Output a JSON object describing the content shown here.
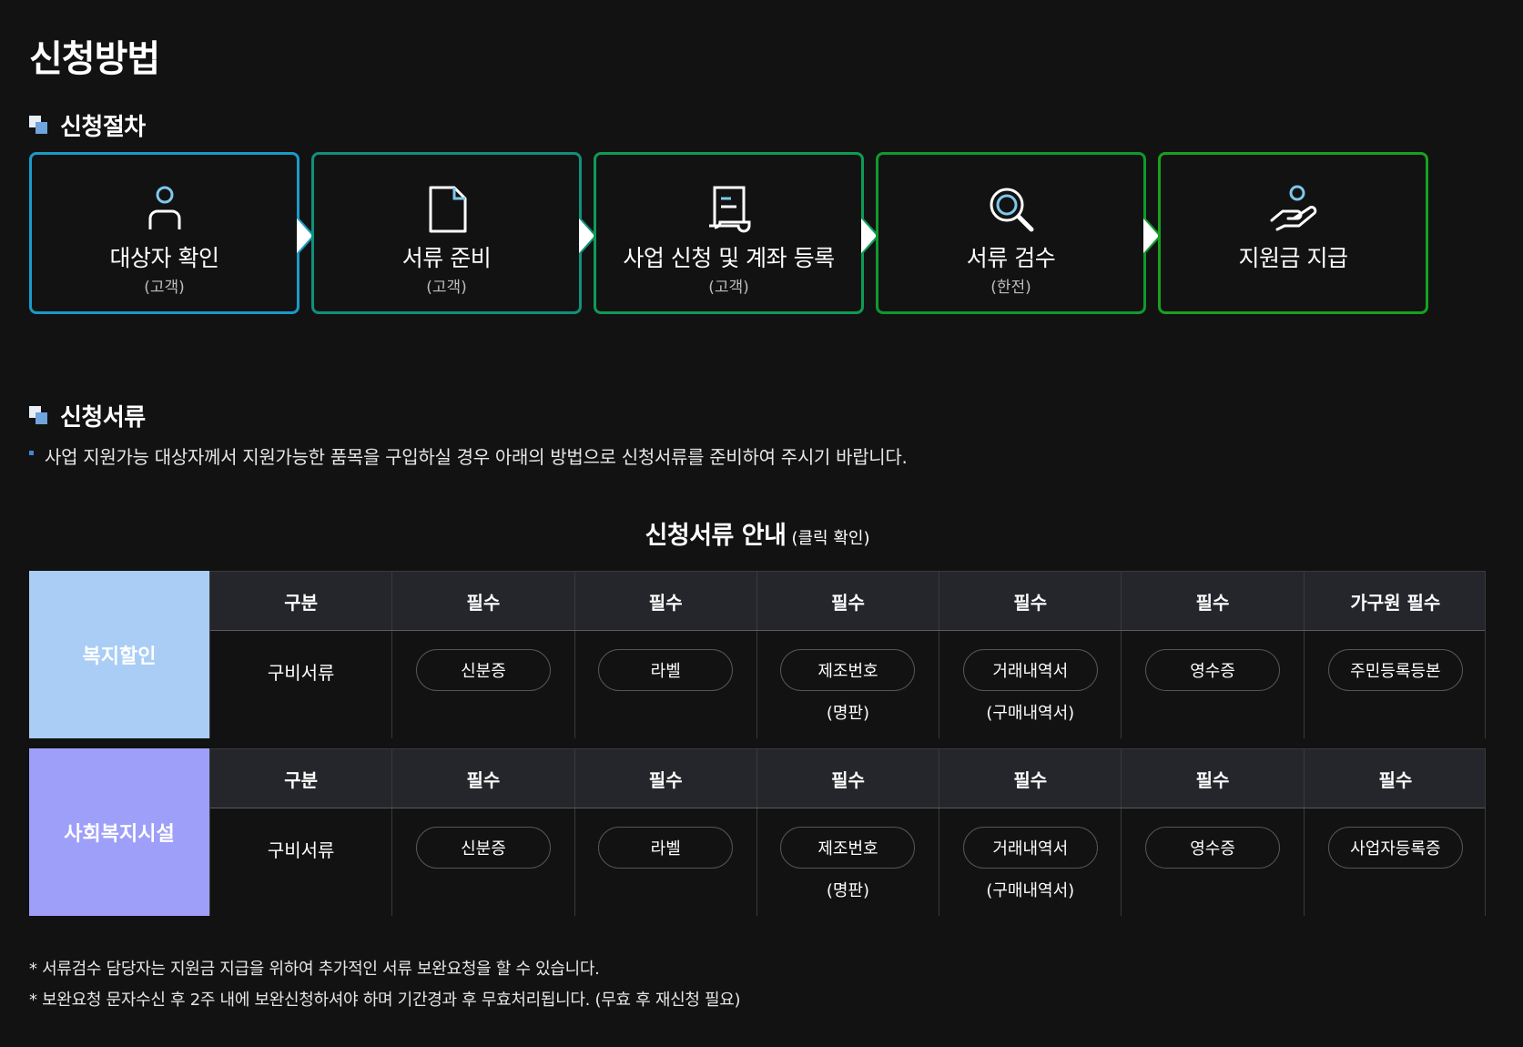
{
  "page_title": "신청방법",
  "procedure": {
    "heading": "신청절차",
    "steps": [
      {
        "name": "대상자 확인",
        "who": "(고객)",
        "icon": "person-icon",
        "color": "#1a9ac8"
      },
      {
        "name": "서류 준비",
        "who": "(고객)",
        "icon": "document-icon",
        "color": "#10907a"
      },
      {
        "name": "사업 신청 및 계좌 등록",
        "who": "(고객)",
        "icon": "form-icon",
        "color": "#0f9a55"
      },
      {
        "name": "서류 검수",
        "who": "(한전)",
        "icon": "magnifier-icon",
        "color": "#0e9a2e"
      },
      {
        "name": "지원금 지급",
        "who": "",
        "icon": "hand-money-icon",
        "color": "#17a21e"
      }
    ]
  },
  "documents": {
    "heading": "신청서류",
    "description": "사업 지원가능 대상자께서 지원가능한 품목을 구입하실 경우 아래의 방법으로 신청서류를 준비하여 주시기 바랍니다.",
    "table_title": "신청서류 안내",
    "table_title_note": "(클릭 확인)",
    "blocks": [
      {
        "category": "복지할인",
        "category_color": "#a9cdf4",
        "headers": [
          "구분",
          "필수",
          "필수",
          "필수",
          "필수",
          "필수",
          "가구원 필수"
        ],
        "row_label": "구비서류",
        "docs": [
          {
            "label": "신분증",
            "sub": ""
          },
          {
            "label": "라벨",
            "sub": ""
          },
          {
            "label": "제조번호",
            "sub": "(명판)"
          },
          {
            "label": "거래내역서",
            "sub": "(구매내역서)"
          },
          {
            "label": "영수증",
            "sub": ""
          },
          {
            "label": "주민등록등본",
            "sub": ""
          }
        ]
      },
      {
        "category": "사회복지시설",
        "category_color": "#9e9ff8",
        "headers": [
          "구분",
          "필수",
          "필수",
          "필수",
          "필수",
          "필수",
          "필수"
        ],
        "row_label": "구비서류",
        "docs": [
          {
            "label": "신분증",
            "sub": ""
          },
          {
            "label": "라벨",
            "sub": ""
          },
          {
            "label": "제조번호",
            "sub": "(명판)"
          },
          {
            "label": "거래내역서",
            "sub": "(구매내역서)"
          },
          {
            "label": "영수증",
            "sub": ""
          },
          {
            "label": "사업자등록증",
            "sub": ""
          }
        ]
      }
    ],
    "notes": [
      "* 서류검수 담당자는 지원금 지급을 위하여 추가적인 서류 보완요청을 할 수 있습니다.",
      "* 보완요청 문자수신 후 2주 내에 보완신청하셔야 하며 기간경과 후 무효처리됩니다. (무효 후 재신청 필요)"
    ]
  }
}
